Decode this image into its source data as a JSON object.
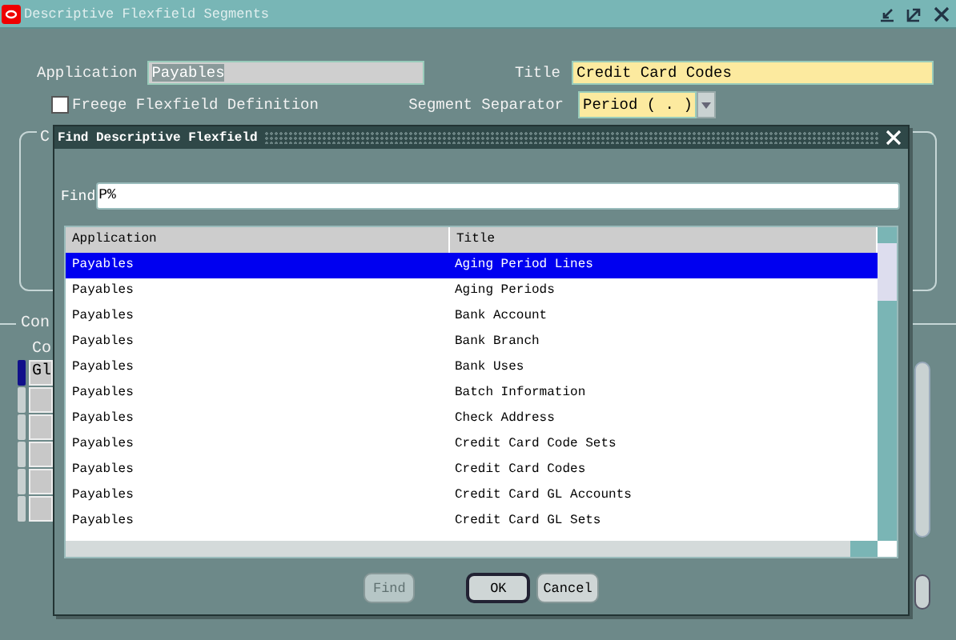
{
  "window": {
    "title": "Descriptive Flexfield Segments"
  },
  "form": {
    "application_label": "Application",
    "application": "Payables",
    "title_label": "Title",
    "title": "Credit Card Codes",
    "freeze_label": "Freege Flexfield Definition",
    "freeze_checked": false,
    "separator_label": "Segment Separator",
    "separator": "Period ( . )"
  },
  "group_1": {
    "label": "C"
  },
  "group_2": {
    "label": "Con",
    "column_1": "Co",
    "rows": [
      {
        "text": "Gl",
        "current": true
      },
      {
        "current": false
      },
      {
        "current": false
      },
      {
        "current": false
      },
      {
        "current": false
      },
      {
        "current": false
      }
    ]
  },
  "dialog": {
    "title": "Find Descriptive Flexfield",
    "find_label": "Find",
    "find_value": "P%",
    "columns": [
      "Application",
      "Title"
    ],
    "rows": [
      {
        "application": "Payables",
        "title": "Aging Period Lines",
        "selected": true
      },
      {
        "application": "Payables",
        "title": "Aging Periods",
        "selected": false
      },
      {
        "application": "Payables",
        "title": "Bank Account",
        "selected": false
      },
      {
        "application": "Payables",
        "title": "Bank Branch",
        "selected": false
      },
      {
        "application": "Payables",
        "title": "Bank Uses",
        "selected": false
      },
      {
        "application": "Payables",
        "title": "Batch Information",
        "selected": false
      },
      {
        "application": "Payables",
        "title": "Check Address",
        "selected": false
      },
      {
        "application": "Payables",
        "title": "Credit Card Code Sets",
        "selected": false
      },
      {
        "application": "Payables",
        "title": "Credit Card Codes",
        "selected": false
      },
      {
        "application": "Payables",
        "title": "Credit Card GL Accounts",
        "selected": false
      },
      {
        "application": "Payables",
        "title": "Credit Card GL Sets",
        "selected": false
      }
    ],
    "buttons": [
      {
        "label": "Find",
        "disabled": true,
        "default": false
      },
      {
        "label": "OK",
        "disabled": false,
        "default": true
      },
      {
        "label": "Cancel",
        "disabled": false,
        "default": false
      }
    ]
  }
}
